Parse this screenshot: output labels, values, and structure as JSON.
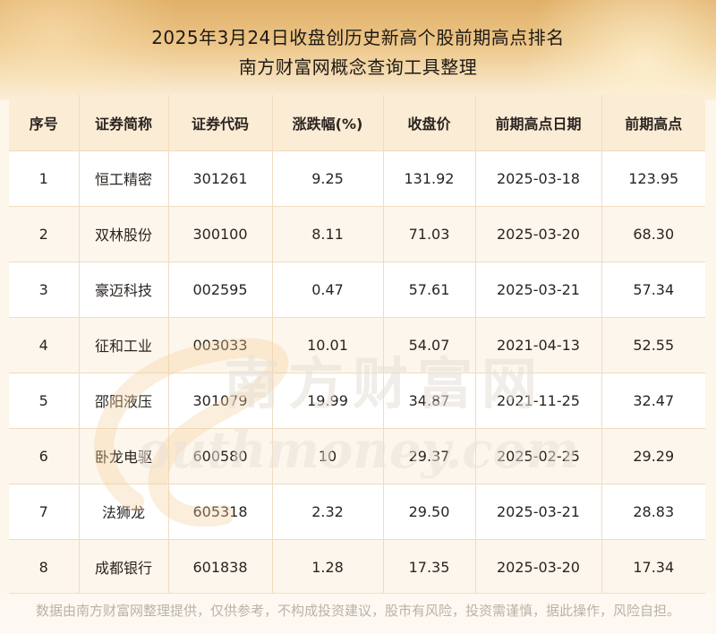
{
  "title_line1": "2025年3月24日收盘创历史新高个股前期高点排名",
  "title_line2": "南方财富网概念查询工具整理",
  "table": {
    "headers": [
      "序号",
      "证券简称",
      "证券代码",
      "涨跌幅(%)",
      "收盘价",
      "前期高点日期",
      "前期高点"
    ],
    "rows": [
      [
        "1",
        "恒工精密",
        "301261",
        "9.25",
        "131.92",
        "2025-03-18",
        "123.95"
      ],
      [
        "2",
        "双林股份",
        "300100",
        "8.11",
        "71.03",
        "2025-03-20",
        "68.30"
      ],
      [
        "3",
        "豪迈科技",
        "002595",
        "0.47",
        "57.61",
        "2025-03-21",
        "57.34"
      ],
      [
        "4",
        "征和工业",
        "003033",
        "10.01",
        "54.07",
        "2021-04-13",
        "52.55"
      ],
      [
        "5",
        "邵阳液压",
        "301079",
        "19.99",
        "34.87",
        "2021-11-25",
        "32.47"
      ],
      [
        "6",
        "卧龙电驱",
        "600580",
        "10",
        "29.37",
        "2025-02-25",
        "29.29"
      ],
      [
        "7",
        "法狮龙",
        "605318",
        "2.32",
        "29.50",
        "2025-03-21",
        "28.83"
      ],
      [
        "8",
        "成都银行",
        "601838",
        "1.28",
        "17.35",
        "2025-03-20",
        "17.34"
      ]
    ]
  },
  "watermark_cn": "南方财富网",
  "watermark_en": "outhmoney.com",
  "disclaimer": "数据由南方财富网整理提供，仅供参考，不构成投资建议，股市有风险，投资需谨慎，据此操作，风险自担。"
}
